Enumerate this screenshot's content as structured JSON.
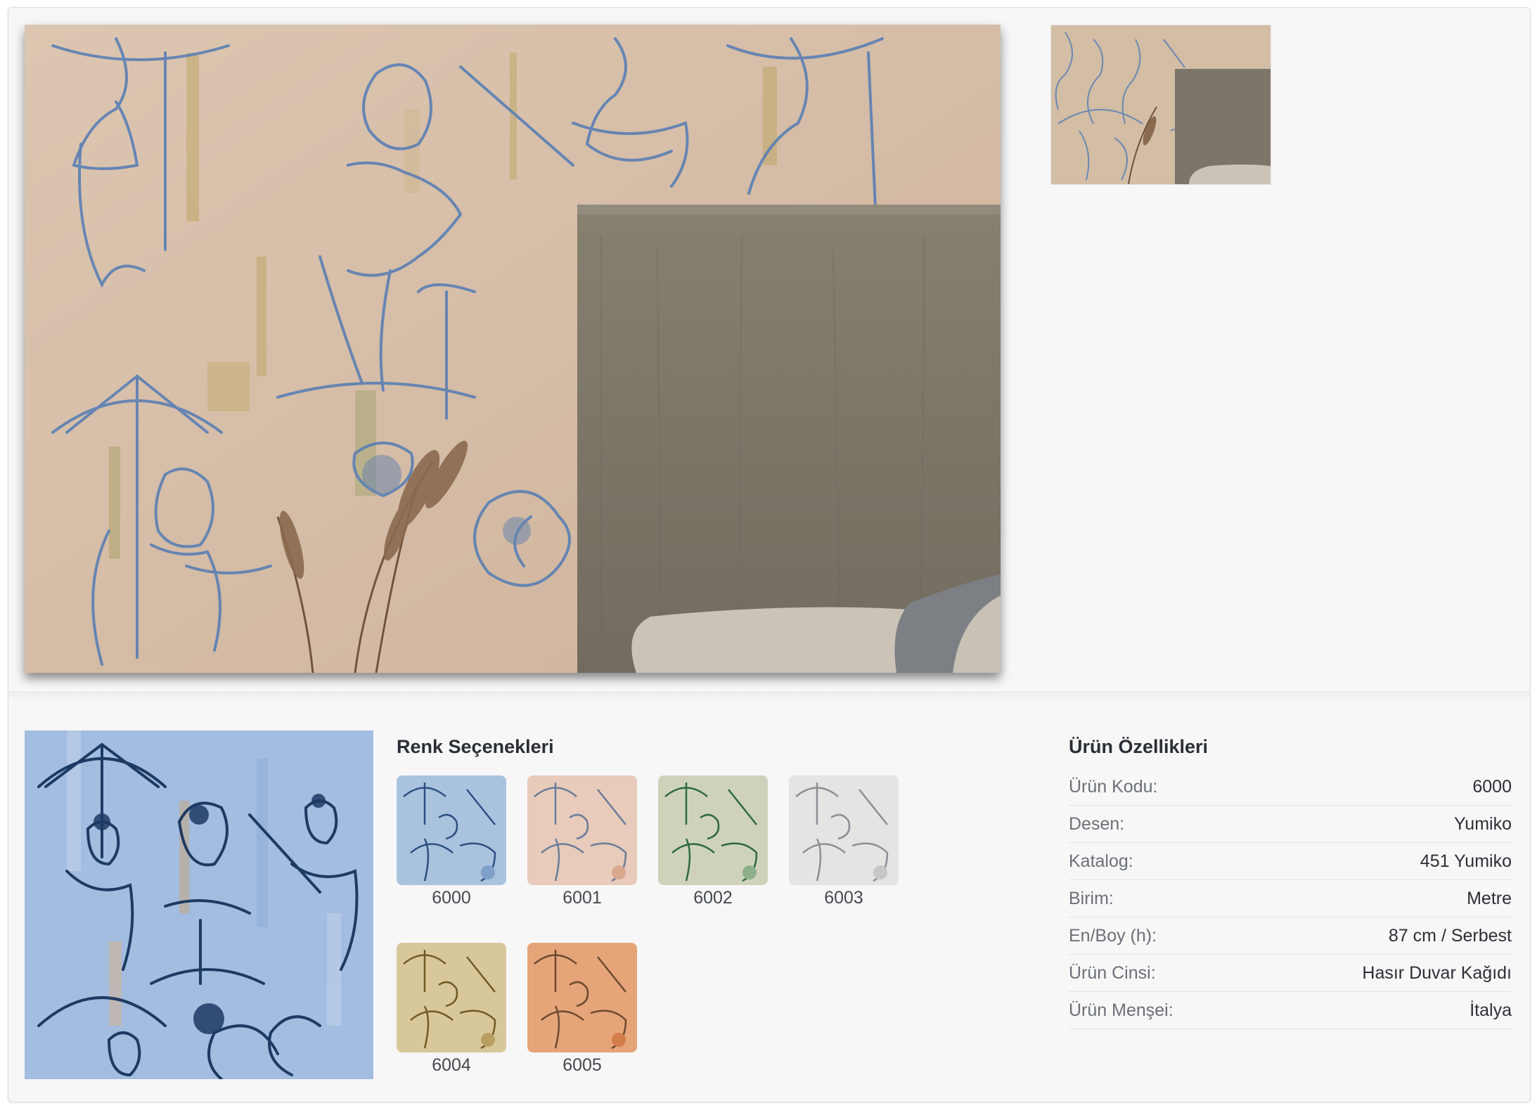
{
  "product_images": {
    "main_alt": "Yumiko wallpaper room view",
    "thumb_alt": "Yumiko wallpaper thumbnail"
  },
  "color_options": {
    "title": "Renk Seçenekleri",
    "items": [
      {
        "code": "6000",
        "bg": "#a9c3df",
        "ink": "#2e4f82",
        "accent": "#7fa0c9"
      },
      {
        "code": "6001",
        "bg": "#e8cbbb",
        "ink": "#6c7c99",
        "accent": "#d9a88e"
      },
      {
        "code": "6002",
        "bg": "#cfd2ba",
        "ink": "#2d6a3a",
        "accent": "#8db08a"
      },
      {
        "code": "6003",
        "bg": "#e4e4e2",
        "ink": "#8c8f95",
        "accent": "#c6c7c9"
      },
      {
        "code": "6004",
        "bg": "#d9c79c",
        "ink": "#6e5b25",
        "accent": "#b79f61"
      },
      {
        "code": "6005",
        "bg": "#e6a579",
        "ink": "#6e4a2e",
        "accent": "#d27e4a"
      }
    ]
  },
  "specs": {
    "title": "Ürün Özellikleri",
    "rows": [
      {
        "label": "Ürün Kodu:",
        "value": "6000"
      },
      {
        "label": "Desen:",
        "value": "Yumiko"
      },
      {
        "label": "Katalog:",
        "value": "451 Yumiko"
      },
      {
        "label": "Birim:",
        "value": "Metre"
      },
      {
        "label": "En/Boy (h):",
        "value": "87 cm / Serbest"
      },
      {
        "label": "Ürün Cinsi:",
        "value": "Hasır Duvar Kağıdı"
      },
      {
        "label": "Ürün Menşei:",
        "value": "İtalya"
      }
    ]
  },
  "colors": {
    "wall": "#d8c2ac",
    "headboard": "#7f776c",
    "sketch": "#5a7fb4",
    "pattern_blue_bg": "#a3bde0"
  }
}
